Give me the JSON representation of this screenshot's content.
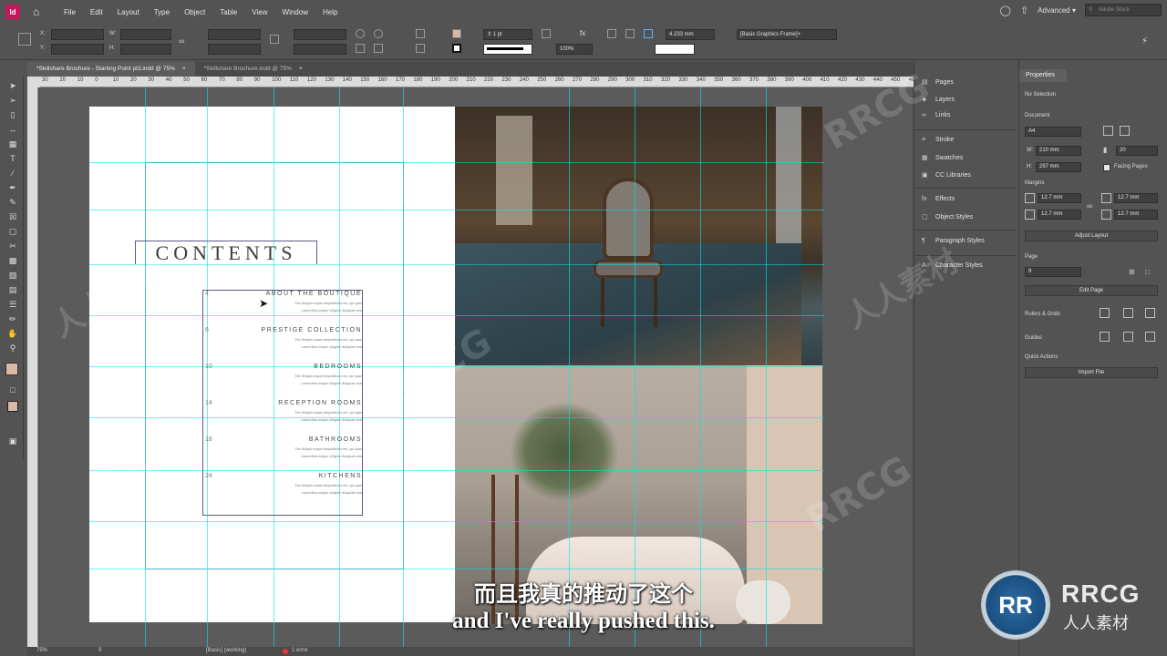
{
  "app": {
    "logo": "Id"
  },
  "menu": [
    "File",
    "Edit",
    "Layout",
    "Type",
    "Object",
    "Table",
    "View",
    "Window",
    "Help"
  ],
  "workspace": "Advanced",
  "stock_search_placeholder": "Adobe Stock",
  "control": {
    "x_label": "X:",
    "y_label": "Y:",
    "w_label": "W:",
    "h_label": "H:",
    "stroke_weight": "1 pt",
    "zoom_percent": "100%",
    "offset": "4.233 mm",
    "object_style": "[Basic Graphics Frame]+"
  },
  "tabs": [
    {
      "label": "*Skillshare Brochure - Starting Point pt3.indd @ 75%",
      "close": "×"
    },
    {
      "label": "*Skillshare Brochure.indd @ 75%",
      "close": "×"
    }
  ],
  "ruler_labels": [
    "30",
    "20",
    "10",
    "0",
    "10",
    "20",
    "30",
    "40",
    "50",
    "60",
    "70",
    "80",
    "90",
    "100",
    "110",
    "120",
    "130",
    "140",
    "150",
    "160",
    "170",
    "180",
    "190",
    "200",
    "210",
    "220",
    "230",
    "240",
    "250",
    "260",
    "270",
    "280",
    "290",
    "300",
    "310",
    "320",
    "330",
    "340",
    "350",
    "360",
    "370",
    "380",
    "390",
    "400",
    "410",
    "420",
    "430",
    "440",
    "450",
    "460"
  ],
  "document": {
    "contents_title": "CONTENTS",
    "toc": [
      {
        "num": "4",
        "title": "ABOUT THE BOUTIQUE",
        "body1": "Unt dolupta sequat inepudistum rest, qui quae",
        "body2": "consertibus meque seligene doluptate non"
      },
      {
        "num": "6",
        "title": "PRESTIGE COLLECTION",
        "body1": "Unt dolupta sequat inepudistum rest, qui quae",
        "body2": "consertibus meque seligene doluptate non"
      },
      {
        "num": "10",
        "title": "BEDROOMS",
        "body1": "Unt dolupta sequat inepudistum rest, qui quae",
        "body2": "consertibus meque seligene doluptate non"
      },
      {
        "num": "14",
        "title": "RECEPTION ROOMS",
        "body1": "Unt dolupta sequat inepudistum rest, qui quae",
        "body2": "consertibus meque seligene doluptate non"
      },
      {
        "num": "18",
        "title": "BATHROOMS",
        "body1": "Unt dolupta sequat inepudistum rest, qui quae",
        "body2": "consertibus meque seligene doluptate non"
      },
      {
        "num": "24",
        "title": "KITCHENS",
        "body1": "Unt dolupta sequat inepudistum rest, qui quae",
        "body2": "consertibus meque seligene doluptate non"
      }
    ]
  },
  "panels": [
    "Pages",
    "Layers",
    "Links",
    "Stroke",
    "Swatches",
    "CC Libraries",
    "Effects",
    "Object Styles",
    "Paragraph Styles",
    "Character Styles"
  ],
  "properties": {
    "title": "Properties",
    "selection": "No Selection",
    "document_label": "Document",
    "page_size": "A4",
    "width_label": "W:",
    "width": "210 mm",
    "height_label": "H:",
    "height": "297 mm",
    "pages_count": "20",
    "facing_pages": "Facing Pages",
    "margins_label": "Margins",
    "margin_top": "12.7 mm",
    "margin_bottom": "12.7 mm",
    "margin_inside": "12.7 mm",
    "margin_outside": "12.7 mm",
    "adjust_layout": "Adjust Layout",
    "page_label": "Page",
    "page_number": "9",
    "edit_page": "Edit Page",
    "rulers_grids": "Rulers & Grids",
    "guides": "Guides",
    "quick_actions": "Quick Actions",
    "import_file": "Import File"
  },
  "status": {
    "zoom": "75%",
    "page": "9",
    "profile": "[Basic] (working)",
    "errors": "1 error"
  },
  "subtitles": {
    "cn": "而且我真的推动了这个",
    "en": "and I've really pushed this."
  },
  "watermark": {
    "text_en": "RRCG",
    "text_cn": "人人素材"
  },
  "brand": {
    "name": "RRCG",
    "sub": "人人素材",
    "badge": "RR"
  },
  "colors": {
    "app_accent": "#c2185b",
    "guide": "#00e6e6",
    "margin_guide": "#a86ad1"
  }
}
